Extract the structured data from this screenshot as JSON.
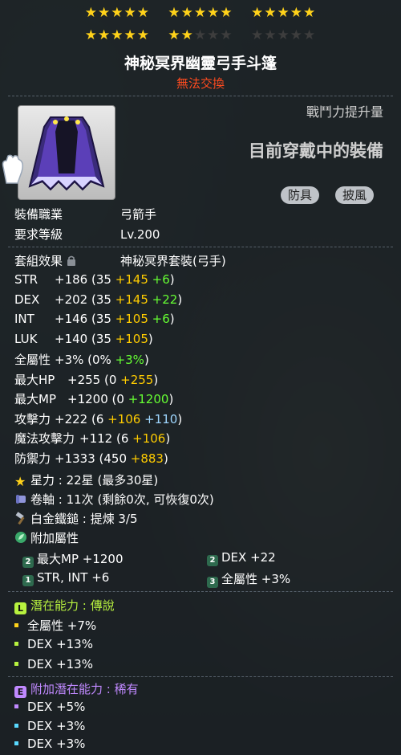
{
  "stars": {
    "row1": [
      "★★★★★",
      "★★★★★",
      "★★★★★"
    ],
    "row2_filled": [
      "★★★★★",
      "★★"
    ],
    "row2_empty": [
      "★★★",
      "★★★★★"
    ]
  },
  "item": {
    "name": "神秘冥界幽靈弓手斗篷",
    "trade_status": "無法交換",
    "cp_label": "戰鬥力提升量",
    "equipped_label": "目前穿戴中的裝備",
    "tags": [
      "防具",
      "披風"
    ]
  },
  "requirements": {
    "job_label": "裝備職業",
    "job_value": "弓箭手",
    "level_label": "要求等級",
    "level_value": "Lv.200"
  },
  "set": {
    "label": "套組效果",
    "value": "神秘冥界套裝(弓手)"
  },
  "stats": [
    {
      "name": "STR",
      "parts": [
        [
          "wht",
          "+186 (35 "
        ],
        [
          "yel",
          "+145"
        ],
        [
          "grn",
          " +6"
        ],
        [
          "wht",
          ")"
        ]
      ]
    },
    {
      "name": "DEX",
      "parts": [
        [
          "wht",
          "+202 (35 "
        ],
        [
          "yel",
          "+145"
        ],
        [
          "grn",
          " +22"
        ],
        [
          "wht",
          ")"
        ]
      ]
    },
    {
      "name": "INT",
      "parts": [
        [
          "wht",
          "+146 (35 "
        ],
        [
          "yel",
          "+105"
        ],
        [
          "grn",
          " +6"
        ],
        [
          "wht",
          ")"
        ]
      ]
    },
    {
      "name": "LUK",
      "parts": [
        [
          "wht",
          "+140 (35 "
        ],
        [
          "yel",
          "+105"
        ],
        [
          "wht",
          ")"
        ]
      ]
    },
    {
      "name": "全屬性",
      "parts": [
        [
          "wht",
          "+3% (0% "
        ],
        [
          "grn",
          "+3%"
        ],
        [
          "wht",
          ")"
        ]
      ]
    },
    {
      "name": "最大HP",
      "parts": [
        [
          "wht",
          "+255 (0 "
        ],
        [
          "yel",
          "+255"
        ],
        [
          "wht",
          ")"
        ]
      ]
    },
    {
      "name": "最大MP",
      "parts": [
        [
          "wht",
          "+1200 (0 "
        ],
        [
          "grn",
          "+1200"
        ],
        [
          "wht",
          ")"
        ]
      ]
    },
    {
      "name": "攻擊力",
      "parts": [
        [
          "wht",
          "+222 (6 "
        ],
        [
          "yel",
          "+106"
        ],
        [
          "blu",
          " +110"
        ],
        [
          "wht",
          ")"
        ]
      ]
    },
    {
      "name": "魔法攻擊力",
      "parts": [
        [
          "wht",
          "+112 (6 "
        ],
        [
          "yel",
          "+106"
        ],
        [
          "wht",
          ")"
        ]
      ]
    },
    {
      "name": "防禦力",
      "parts": [
        [
          "wht",
          "+1333 (450 "
        ],
        [
          "yel",
          "+883"
        ],
        [
          "wht",
          ")"
        ]
      ]
    }
  ],
  "upgrades": {
    "starforce": "星力 : 22星 (最多30星)",
    "scroll": "卷軸 : 11次 (剩餘0次, 可恢復0次)",
    "hammer": "白金鐵鎚 : 提煉 3/5",
    "bonus_label": "附加屬性"
  },
  "bonus_stats": [
    {
      "badge": "2",
      "text": "最大MP +1200"
    },
    {
      "badge": "2",
      "text": "DEX  +22"
    },
    {
      "badge": "1",
      "text": "STR, INT  +6"
    },
    {
      "badge": "3",
      "text": "全屬性  +3%"
    }
  ],
  "potential": {
    "tag": "L",
    "label": "潛在能力 : 傳說",
    "lines": [
      "全屬性 +7%",
      "DEX +13%",
      "DEX +13%"
    ]
  },
  "additional_potential": {
    "tag": "E",
    "label": "附加潛在能力 : 稀有",
    "lines": [
      "DEX +5%",
      "DEX +3%",
      "DEX +3%"
    ]
  },
  "colors": {
    "legendary": "#b7f13f",
    "epic": "#c089ff",
    "star": "#ffd21a",
    "trade": "#ff4b1f"
  }
}
